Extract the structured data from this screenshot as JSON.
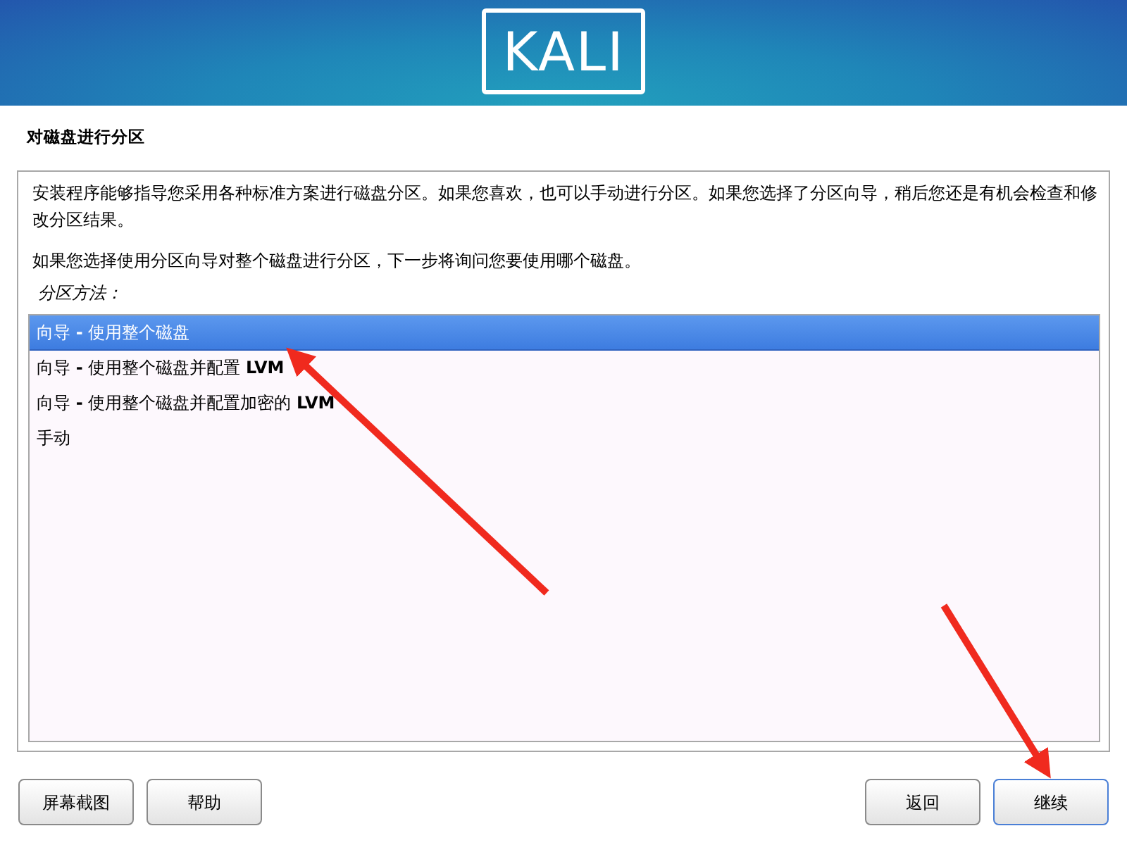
{
  "header": {
    "logo": "KALI"
  },
  "title": "对磁盘进行分区",
  "description": [
    "安装程序能够指导您采用各种标准方案进行磁盘分区。如果您喜欢，也可以手动进行分区。如果您选择了分区向导，稍后您还是有机会检查和修改分区结果。",
    "如果您选择使用分区向导对整个磁盘进行分区，下一步将询问您要使用哪个磁盘。"
  ],
  "list_label": "分区方法：",
  "options": [
    {
      "label": "向导 **-** 使用整个磁盘",
      "selected": true
    },
    {
      "label": "向导 **-** 使用整个磁盘并配置 **LVM**",
      "selected": false
    },
    {
      "label": "向导 **-** 使用整个磁盘并配置加密的 **LVM**",
      "selected": false
    },
    {
      "label": "手动",
      "selected": false
    }
  ],
  "buttons_left": [
    "屏幕截图",
    "帮助"
  ],
  "buttons_right": [
    {
      "label": "返回",
      "selected": false
    },
    {
      "label": "继续",
      "selected": true
    }
  ]
}
